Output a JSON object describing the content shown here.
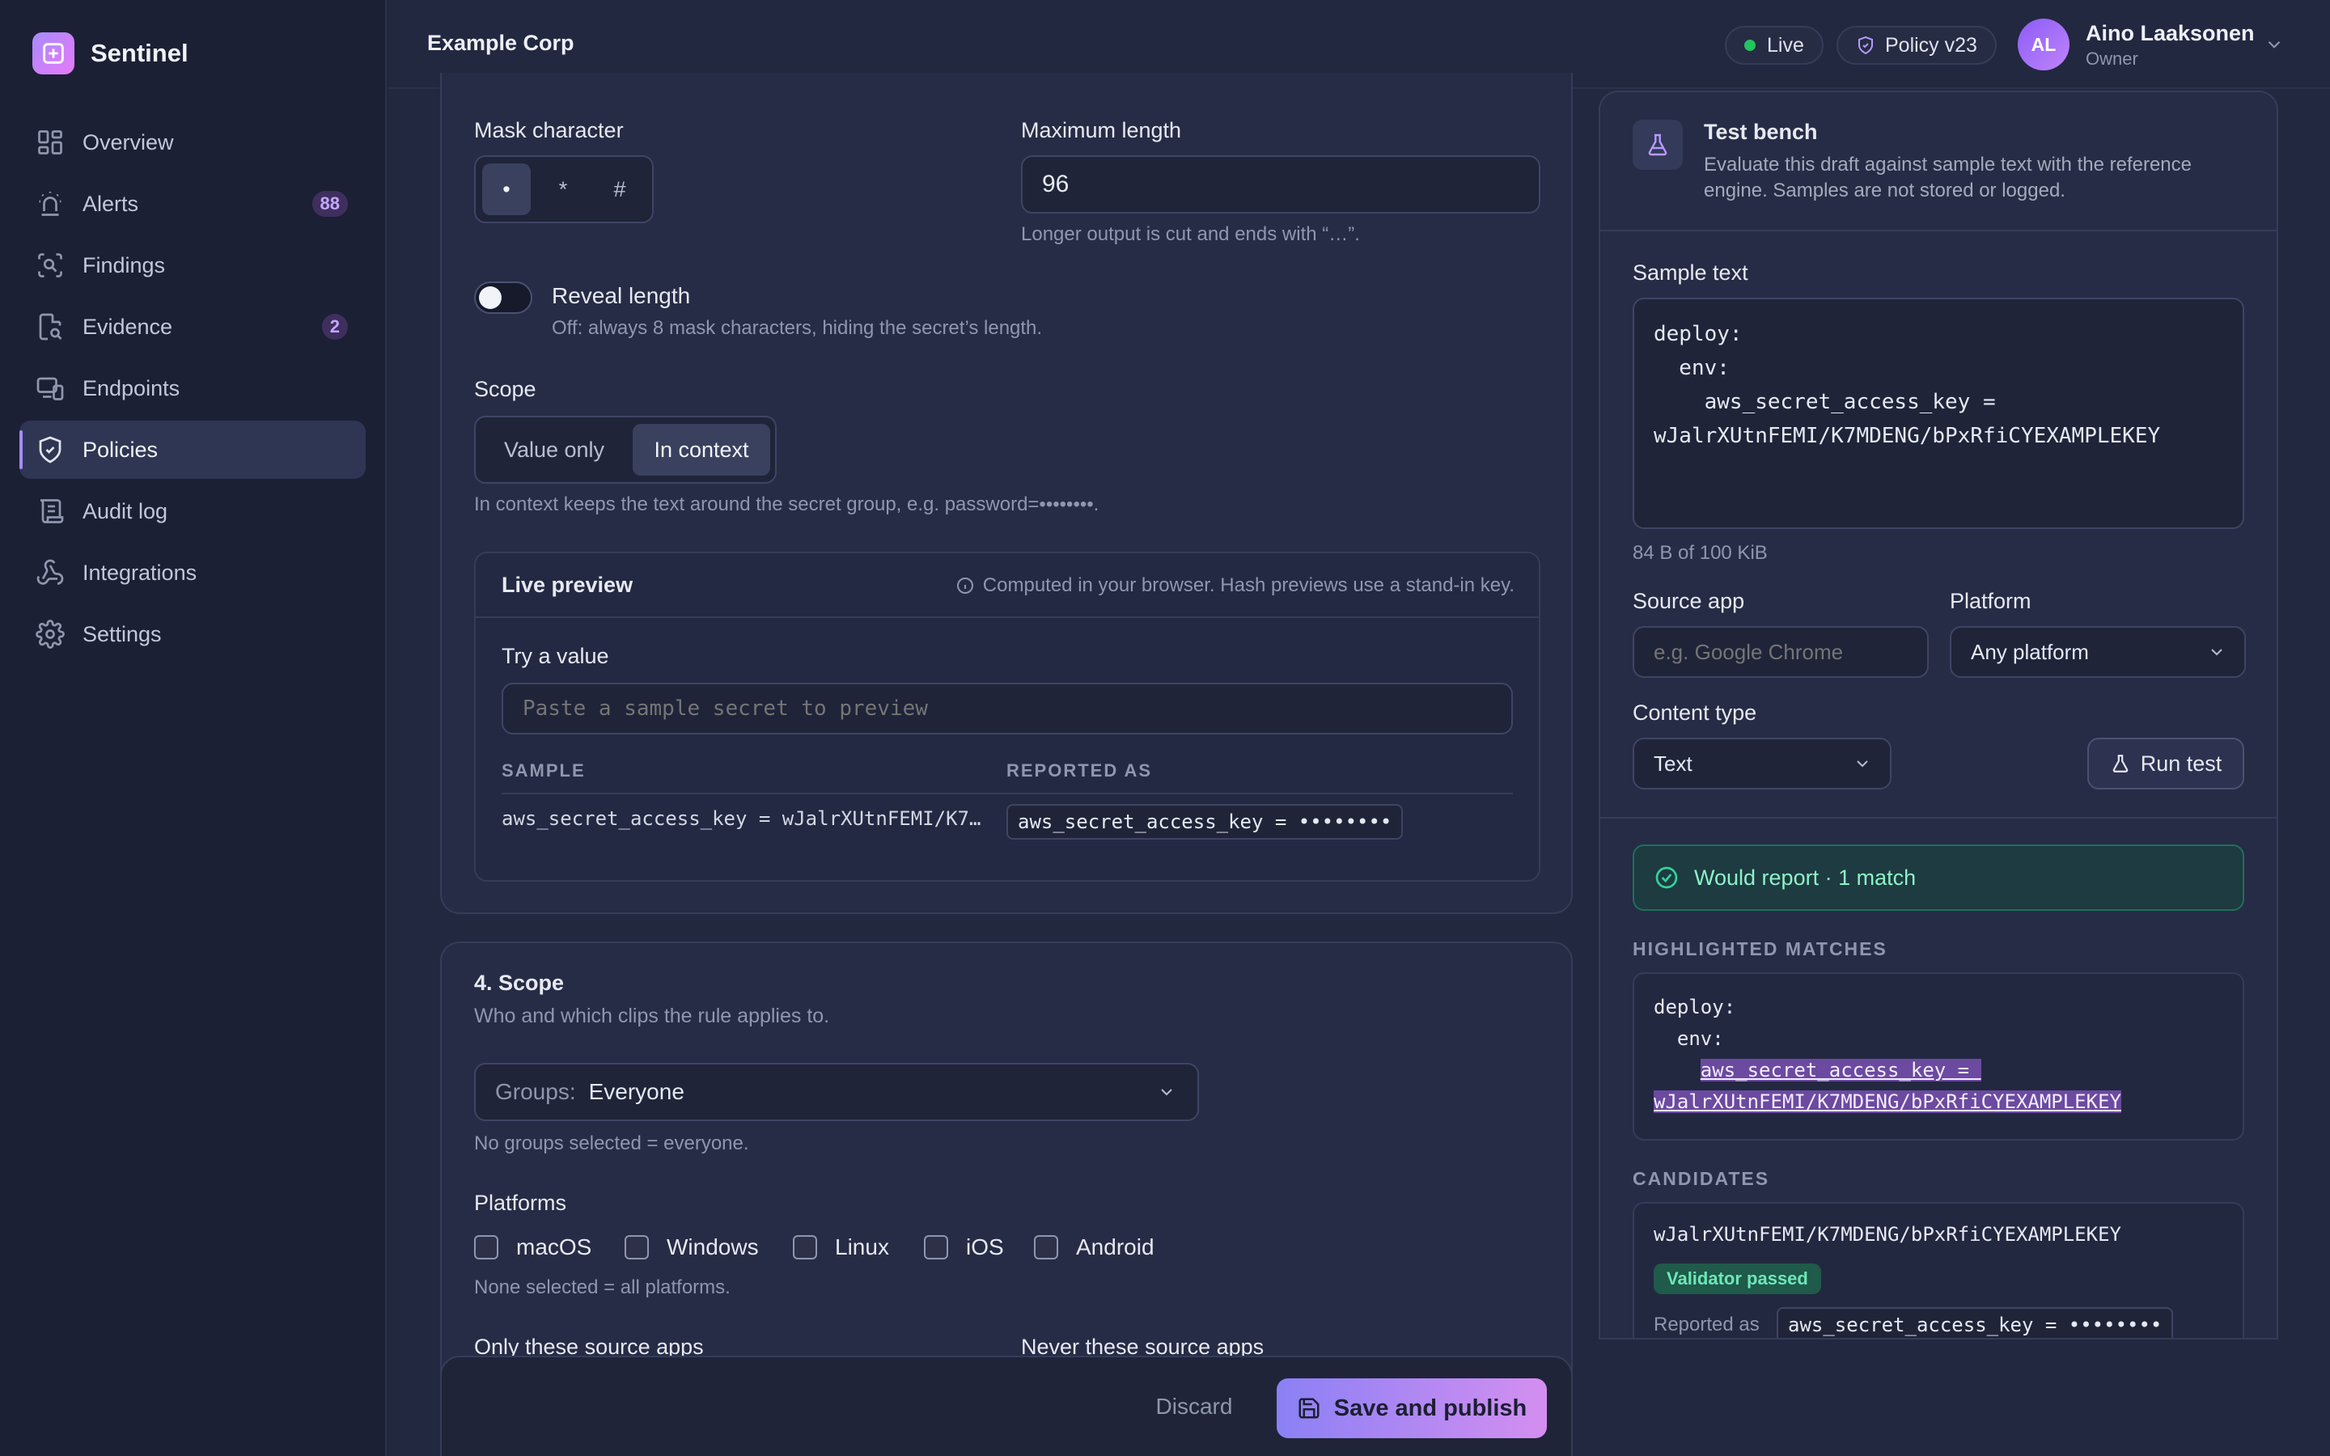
{
  "app": {
    "name": "Sentinel"
  },
  "nav": [
    {
      "label": "Overview",
      "icon": "grid-icon"
    },
    {
      "label": "Alerts",
      "icon": "siren-icon",
      "badge": "88"
    },
    {
      "label": "Findings",
      "icon": "scan-search-icon"
    },
    {
      "label": "Evidence",
      "icon": "file-search-icon",
      "badge": "2"
    },
    {
      "label": "Endpoints",
      "icon": "devices-icon"
    },
    {
      "label": "Policies",
      "icon": "shield-check-icon",
      "active": true
    },
    {
      "label": "Audit log",
      "icon": "scroll-icon"
    },
    {
      "label": "Integrations",
      "icon": "webhook-icon"
    },
    {
      "label": "Settings",
      "icon": "gear-icon"
    }
  ],
  "topbar": {
    "org": "Example Corp",
    "status": "Live",
    "policy": "Policy v23",
    "user": {
      "initials": "AL",
      "name": "Aino Laaksonen",
      "role": "Owner"
    }
  },
  "masking": {
    "mask_character": {
      "label": "Mask character",
      "options": [
        "•",
        "*",
        "#"
      ],
      "selected": "•"
    },
    "max_length": {
      "label": "Maximum length",
      "value": "96",
      "help": "Longer output is cut and ends with “…”."
    },
    "reveal_length": {
      "label": "Reveal length",
      "help": "Off: always 8 mask characters, hiding the secret’s length.",
      "on": false
    },
    "scope": {
      "label": "Scope",
      "options": [
        "Value only",
        "In context"
      ],
      "selected": "In context",
      "help": "In context keeps the text around the secret group, e.g. password=••••••••."
    },
    "preview": {
      "title": "Live preview",
      "note": "Computed in your browser. Hash previews use a stand-in key.",
      "try_label": "Try a value",
      "try_placeholder": "Paste a sample secret to preview",
      "col_sample": "SAMPLE",
      "col_reported": "REPORTED AS",
      "row_sample": "aws_secret_access_key = wJalrXUtnFEMI/K7…",
      "row_reported": "aws_secret_access_key = ••••••••"
    }
  },
  "scope_section": {
    "title": "4. Scope",
    "subtitle": "Who and which clips the rule applies to.",
    "groups_label": "Groups:",
    "groups_value": "Everyone",
    "groups_help": "No groups selected = everyone.",
    "platforms_label": "Platforms",
    "platforms": [
      "macOS",
      "Windows",
      "Linux",
      "iOS",
      "Android"
    ],
    "platforms_help": "None selected = all platforms.",
    "only_apps_label": "Only these source apps",
    "never_apps_label": "Never these source apps"
  },
  "footer": {
    "discard": "Discard",
    "publish": "Save and publish"
  },
  "testbench": {
    "title": "Test bench",
    "desc_line1": "Evaluate this draft against sample text with the reference",
    "desc_line2": "engine. Samples are not stored or logged.",
    "sample_label": "Sample text",
    "sample_lines": [
      "deploy:",
      "  env:",
      "    aws_secret_access_key =",
      "wJalrXUtnFEMI/K7MDENG/bPxRfiCYEXAMPLEKEY"
    ],
    "sample_size": "84 B of 100 KiB",
    "source_app_label": "Source app",
    "source_app_placeholder": "e.g. Google Chrome",
    "platform_label": "Platform",
    "platform_value": "Any platform",
    "content_type_label": "Content type",
    "content_type_value": "Text",
    "run": "Run test",
    "result": "Would report · 1 match",
    "highlighted_title": "HIGHLIGHTED MATCHES",
    "hl_line1": "deploy:",
    "hl_line2": "  env:",
    "hl_match1": "aws_secret_access_key = ",
    "hl_match2": "wJalrXUtnFEMI/K7MDENG/bPxRfiCYEXAMPLEKEY",
    "candidates_title": "CANDIDATES",
    "candidate_value": "wJalrXUtnFEMI/K7MDENG/bPxRfiCYEXAMPLEKEY",
    "validator": "Validator passed",
    "reported_as_label": "Reported as",
    "reported_as_value": "aws_secret_access_key = ••••••••"
  },
  "colors": {
    "accent": "#a78bfa",
    "success": "#34d399",
    "live": "#22c55e"
  }
}
